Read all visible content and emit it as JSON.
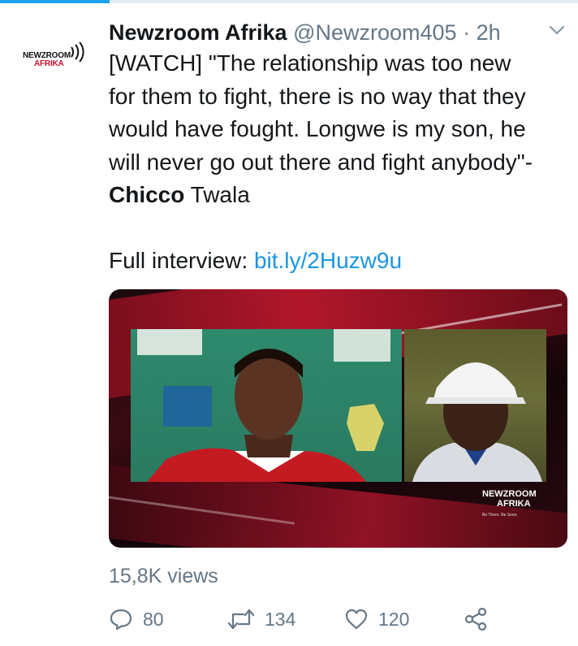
{
  "tweet": {
    "author_name": "Newzroom Afrika",
    "handle": "@Newzroom405",
    "separator": "·",
    "time": "2h",
    "avatar_logo_line1": "NEWZROOM",
    "avatar_logo_line2": "AFRIKA",
    "text_line1": "[WATCH] \"The relationship was too new",
    "text_line2": "for them to fight, there is no way that they",
    "text_line3": "would have fought. Longwe is my son, he",
    "text_line4": "will never go out there and fight anybody\"-",
    "text_bold": "Chicco",
    "text_after_bold": " Twala",
    "interview_label": "Full interview: ",
    "interview_link": "bit.ly/2Huzw9u",
    "media": {
      "logo_line1": "NEWZROOM",
      "logo_line2": "AFRIKA",
      "logo_tagline": "Be There. Be Seen."
    },
    "views": "15,8K views"
  },
  "actions": {
    "replies": "80",
    "retweets": "134",
    "likes": "120"
  },
  "colors": {
    "link": "#1b95e0",
    "muted": "#657786",
    "brand_red": "#c8102e"
  }
}
